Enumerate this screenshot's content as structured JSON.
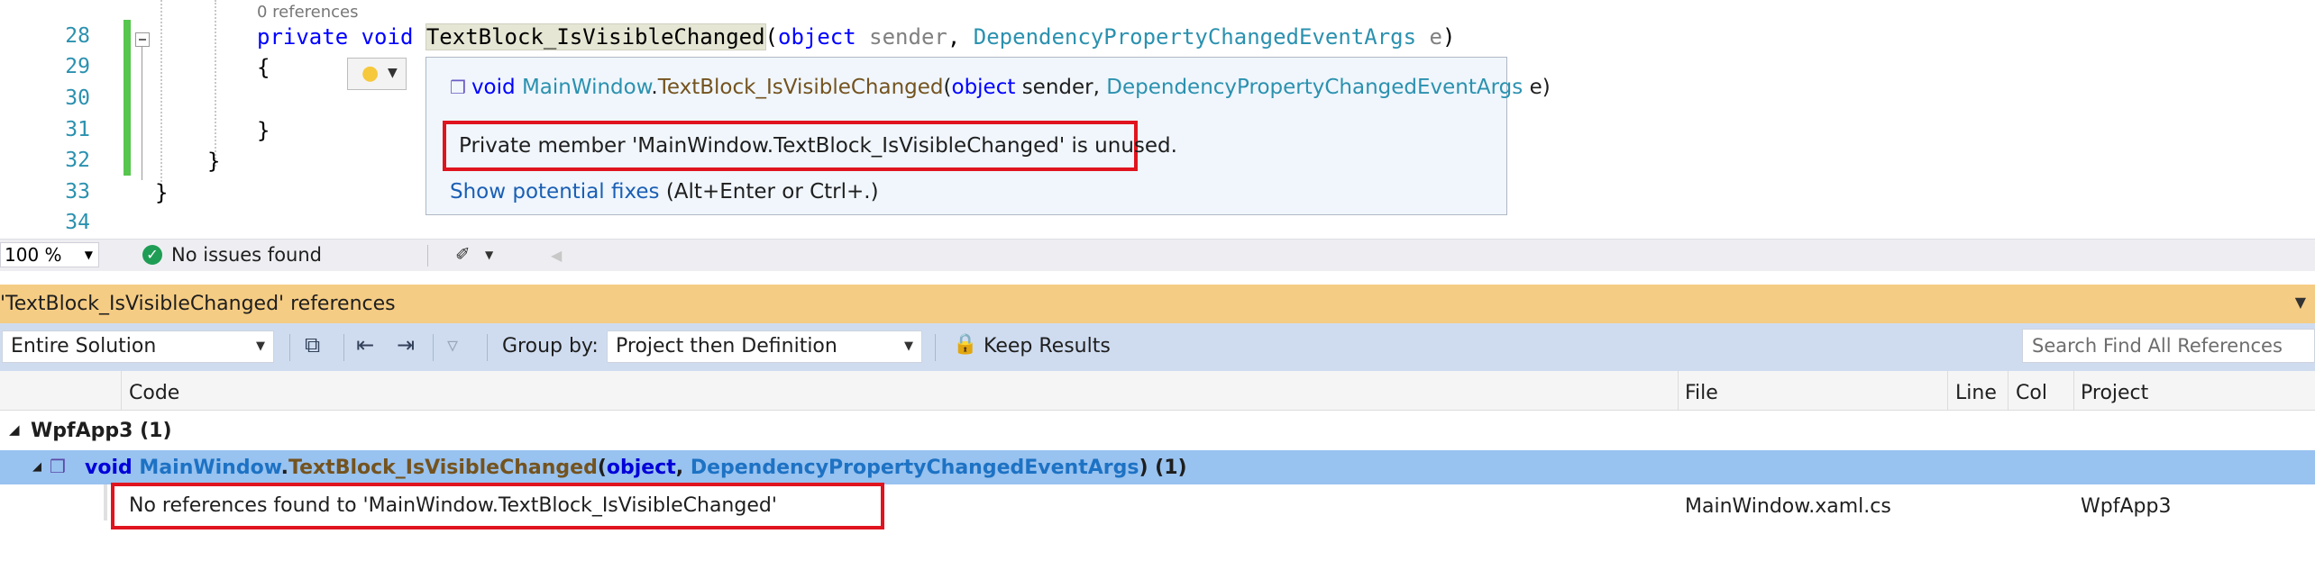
{
  "editor": {
    "code_lens": "0 references",
    "line_numbers": [
      "28",
      "29",
      "30",
      "31",
      "32",
      "33",
      "34"
    ],
    "line28": {
      "kw1": "private",
      "kw2": "void",
      "method": "TextBlock_IsVisibleChanged",
      "paren_open": "(",
      "kw3": "object",
      "param1": "sender",
      "comma": ",",
      "type": "DependencyPropertyChangedEventArgs",
      "param2": "e",
      "paren_close": ")"
    },
    "brace_open": "{",
    "brace_close_inner": "}",
    "brace_close_class": "}",
    "brace_close_ns": "}"
  },
  "lightbulb": {
    "icon": "lightbulb-icon"
  },
  "tooltip": {
    "icon": "private-method-icon",
    "sig_void": "void",
    "sig_class": "MainWindow",
    "sig_dot": ".",
    "sig_method": "TextBlock_IsVisibleChanged",
    "sig_paren": "(",
    "sig_object": "object",
    "sig_sender": " sender, ",
    "sig_type": "DependencyPropertyChangedEventArgs",
    "sig_end": " e)",
    "message": "Private member 'MainWindow.TextBlock_IsVisibleChanged' is unused.",
    "fix_link": "Show potential fixes",
    "fix_hint": " (Alt+Enter or Ctrl+.)"
  },
  "status": {
    "zoom": "100 %",
    "issues": "No issues found"
  },
  "refs_panel": {
    "title": "'TextBlock_IsVisibleChanged' references",
    "scope": "Entire Solution",
    "group_by_label": "Group by:",
    "group_by_value": "Project then Definition",
    "keep_results": "Keep Results",
    "search_placeholder": "Search Find All References",
    "columns": [
      "Code",
      "File",
      "Line",
      "Col",
      "Project"
    ],
    "group": {
      "name": "WpfApp3",
      "count": "(1)"
    },
    "definition": {
      "void": "void",
      "class": "MainWindow",
      "dot": ".",
      "method": "TextBlock_IsVisibleChanged",
      "paren": "(",
      "object": "object",
      "comma": ", ",
      "type": "DependencyPropertyChangedEventArgs",
      "close": ")",
      "count": " (1)"
    },
    "reference": {
      "text": "No references found to 'MainWindow.TextBlock_IsVisibleChanged'",
      "file": "MainWindow.xaml.cs",
      "project": "WpfApp3"
    }
  },
  "colors": {
    "highlight_border": "#e0141e",
    "panel_title_bg": "#f5cc84",
    "selected_row_bg": "#98c2ef",
    "change_bar": "#57c64e"
  }
}
